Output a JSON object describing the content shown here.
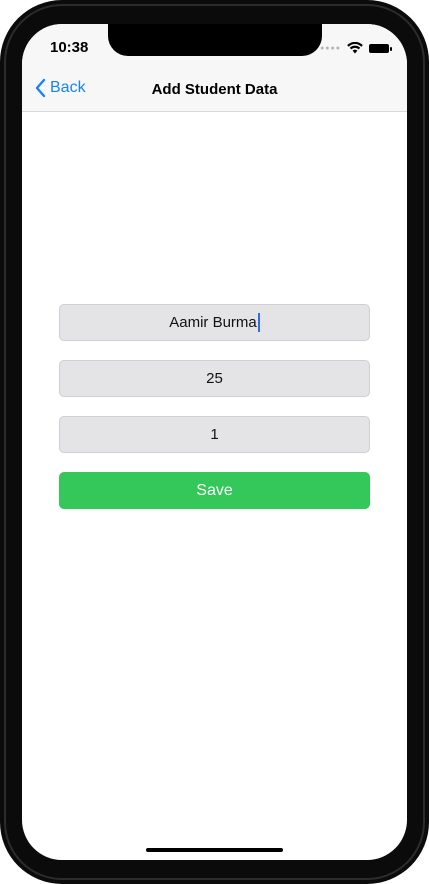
{
  "status_bar": {
    "time": "10:38",
    "icons": [
      "signal-dots-icon",
      "wifi-icon",
      "battery-icon"
    ]
  },
  "nav": {
    "back_label": "Back",
    "title": "Add Student Data"
  },
  "form": {
    "name_value": "Aamir Burma",
    "age_value": "25",
    "roll_value": "1",
    "save_label": "Save"
  },
  "colors": {
    "accent": "#1a82f7",
    "save_button": "#34c759",
    "field_background": "#e4e4e6"
  }
}
